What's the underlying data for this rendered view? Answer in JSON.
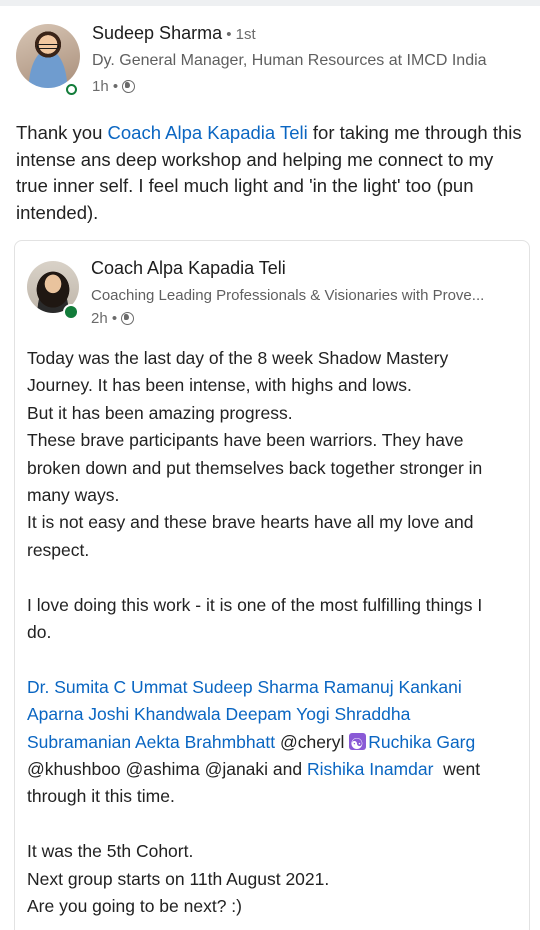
{
  "post": {
    "author_name": "Sudeep Sharma",
    "connection_degree": " • 1st",
    "headline": "Dy. General Manager, Human Resources at IMCD India",
    "time": "1h •",
    "visibility_icon": "globe-icon",
    "text_part1": "Thank you ",
    "mention": "Coach Alpa Kapadia Teli",
    "text_part2": " for taking me through this intense ans deep workshop and helping me connect to my true inner self. I feel much light and 'in the light' too (pun intended)."
  },
  "shared_post": {
    "author_name": "Coach Alpa Kapadia Teli",
    "headline": "Coaching Leading Professionals & Visionaries with Prove...",
    "time": "2h •",
    "visibility_icon": "globe-icon",
    "lines": [
      "Today was the last day of the 8 week Shadow Mastery",
      "Journey. It has been intense, with highs and lows.",
      "But it has been amazing progress.",
      "These brave participants have been warriors. They have",
      "broken down and put themselves back together stronger in",
      "many ways.",
      "It is not easy and these brave hearts have all my love and",
      "respect."
    ],
    "para2": [
      "I love doing this work - it is one of the most fulfilling things I",
      "do."
    ],
    "tags_line1": "Dr. Sumita C Ummat Sudeep Sharma Ramanuj Kankani",
    "tags_line2": "Aparna Joshi Khandwala Deepam Yogi Shraddha",
    "tags_line3_link": "Subramanian Aekta Brahmbhatt",
    "tags_line3_text": " @cheryl ",
    "tags_line3_link2": "Ruchika Garg",
    "tags_line4_text": "@khushboo  @ashima @janaki and ",
    "tags_line4_link": "Rishika Inamdar",
    "tags_line4_tail": "  went",
    "tags_line5": "through it this time.",
    "closing": [
      "It was the 5th Cohort.",
      "Next group starts on 11th August 2021.",
      "Are you going to be next? :)"
    ]
  }
}
